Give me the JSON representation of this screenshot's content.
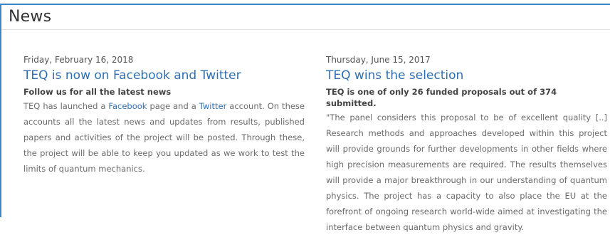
{
  "header": {
    "title": "News"
  },
  "posts": [
    {
      "date": "Friday, February 16, 2018",
      "title": "TEQ is now on Facebook and Twitter",
      "subtitle": "Follow us for all the latest news",
      "body_parts": {
        "p1": "TEQ has launched a ",
        "link1": "Facebook",
        "p2": " page and a ",
        "link2": "Twitter",
        "p3": " account. On these accounts all the latest news and updates from results, published papers and activities of the project will be posted. Through these, the project will be able to keep you updated as we work to test the limits of quantum mechanics."
      }
    },
    {
      "date": "Thursday, June 15, 2017",
      "title": "TEQ wins the selection",
      "subtitle": "TEQ is one of only 26 funded proposals out of 374 submitted.",
      "body": "\"The panel considers this proposal to be of excellent quality [..] Research methods and approaches developed within this project will provide grounds for further developments in other fields where high precision measurements are required. The results themselves will provide a major breakthrough in our understanding of quantum physics. The project has a capacity to also place the EU at the forefront of ongoing research world-wide aimed at investigating the interface between quantum physics and gravity."
    }
  ],
  "colors": {
    "accent": "#3a86c6",
    "link": "#2f6fb0",
    "text": "#6a6a6a"
  }
}
